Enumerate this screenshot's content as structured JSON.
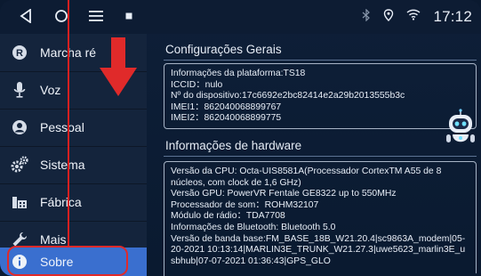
{
  "status_bar": {
    "time": "17:12",
    "icons": [
      "back-triangle-icon",
      "home-circle-icon",
      "menu-icon",
      "notification-icon",
      "bluetooth-icon",
      "location-icon",
      "wifi-icon"
    ]
  },
  "sidebar": {
    "items": [
      {
        "label": "Marcha ré",
        "icon": "r-circle-icon"
      },
      {
        "label": "Voz",
        "icon": "microphone-icon"
      },
      {
        "label": "Pessoal",
        "icon": "person-icon"
      },
      {
        "label": "Sistema",
        "icon": "gears-icon"
      },
      {
        "label": "Fábrica",
        "icon": "factory-icon"
      },
      {
        "label": "Mais",
        "icon": "wrench-icon"
      },
      {
        "label": "Sobre",
        "icon": "info-icon"
      }
    ],
    "selected": "Sobre"
  },
  "content": {
    "section1_title": "Configurações Gerais",
    "platform_info": [
      "Informações da plataforma:TS18",
      "ICCID：nulo",
      "Nº do dispositivo:17c6692e2bc82414e2a29b2013555b3c",
      "IMEI1：862040068899767",
      "IMEI2：862040068899775"
    ],
    "section2_title": "Informações de hardware",
    "hardware_info": [
      "Versão da CPU: Octa-UIS8581A(Processador CortexTM A55 de 8 núcleos, com clock de 1,6 GHz)",
      "Versão GPU: PowerVR Fentale GE8322 up to 550MHz",
      "Processador de som：ROHM32107",
      "Módulo de rádio：TDA7708",
      "Informações de Bluetooth: Bluetooth 5.0",
      "Versão de banda base:FM_BASE_18B_W21.20.4|sc9863A_modem|05-20-2021 10:13:14|MARLIN3E_TRUNK_W21.27.3|uwe5623_marlin3E_usbhub|07-07-2021 01:36:43|GPS_GLO"
    ]
  },
  "colors": {
    "background": "#0b1a30",
    "sidebar": "#14243c",
    "selected": "#3a6fcf",
    "annotation_red": "#e02a2a"
  }
}
